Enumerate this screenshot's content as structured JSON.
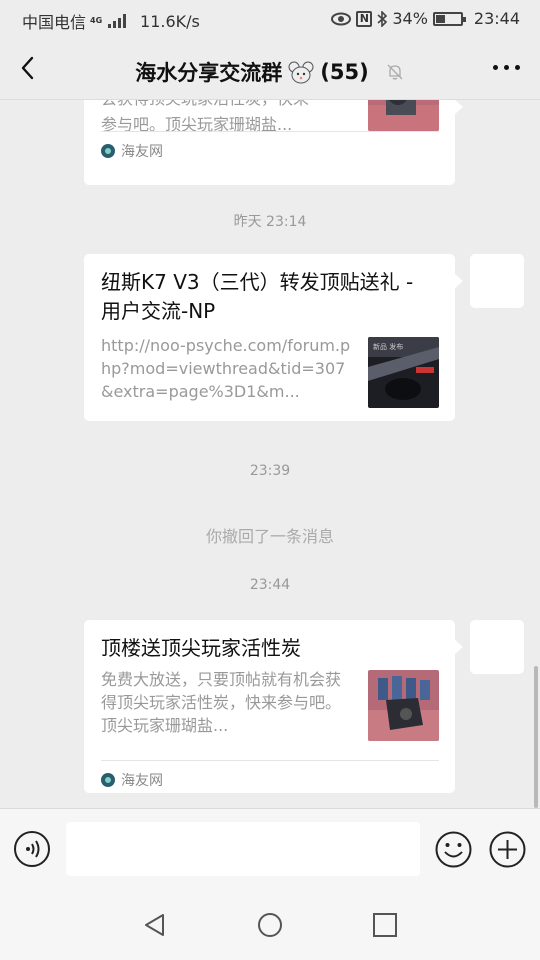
{
  "status": {
    "carrier": "中国电信",
    "network_gen": "4G",
    "speed": "11.6K/s",
    "nfc": "N",
    "battery": "34%",
    "time": "23:44"
  },
  "header": {
    "title": "海水分享交流群",
    "member_count": "(55)",
    "back_icon": "back-chevron-icon",
    "mute_icon": "bell-off-icon",
    "more_icon": "more-dots-icon"
  },
  "messages": {
    "top_card": {
      "title_partial": "会获得顶尖玩家活性炭，快来",
      "desc_line": "参与吧。顶尖玩家珊瑚盐...",
      "source": "海友网"
    },
    "ts1": "昨天 23:14",
    "card2": {
      "title": "纽斯K7 V3（三代）转发顶贴送礼 - 用户交流-NP",
      "desc": "http://noo-psyche.com/forum.php?mod=viewthread&tid=307&extra=page%3D1&m..."
    },
    "ts2": "23:39",
    "recall": "你撤回了一条消息",
    "ts3": "23:44",
    "card3": {
      "title": "顶楼送顶尖玩家活性炭",
      "desc": "免费大放送，只要顶帖就有机会获得顶尖玩家活性炭，快来参与吧。顶尖玩家珊瑚盐...",
      "source": "海友网"
    }
  },
  "inputbar": {
    "placeholder": "",
    "voice_icon": "voice-icon",
    "emoji_icon": "emoji-icon",
    "plus_icon": "plus-icon"
  },
  "navbar": {
    "back": "nav-back-icon",
    "home": "nav-home-icon",
    "recents": "nav-recents-icon"
  }
}
